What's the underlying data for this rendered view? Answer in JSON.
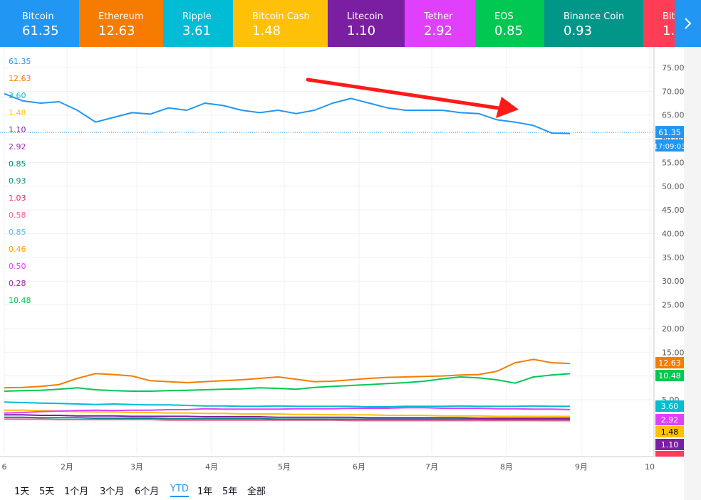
{
  "tiles": [
    {
      "name": "Bitcoin",
      "value": "61.35",
      "color": "#2196f3"
    },
    {
      "name": "Ethereum",
      "value": "12.63",
      "color": "#f57c00"
    },
    {
      "name": "Ripple",
      "value": "3.61",
      "color": "#00bcd4"
    },
    {
      "name": "Bitcoin Cash",
      "value": "1.48",
      "color": "#ffc107"
    },
    {
      "name": "Litecoin",
      "value": "1.10",
      "color": "#7b1fa2"
    },
    {
      "name": "Tether",
      "value": "2.92",
      "color": "#e040fb"
    },
    {
      "name": "EOS",
      "value": "0.85",
      "color": "#00c853"
    },
    {
      "name": "Binance Coin",
      "value": "0.93",
      "color": "#009688"
    },
    {
      "name": "Bit",
      "value": "1.",
      "color": "#ff3d57"
    }
  ],
  "next_icon": "chevron-right-icon",
  "legend_values": [
    {
      "text": "61.35",
      "color": "#2196f3"
    },
    {
      "text": "12.63",
      "color": "#f57c00"
    },
    {
      "text": "3.60",
      "color": "#00bcd4"
    },
    {
      "text": "1.48",
      "color": "#ffc107"
    },
    {
      "text": "1.10",
      "color": "#7b1fa2"
    },
    {
      "text": "2.92",
      "color": "#9c27b0"
    },
    {
      "text": "0.85",
      "color": "#00897b"
    },
    {
      "text": "0.93",
      "color": "#009688"
    },
    {
      "text": "1.03",
      "color": "#e91e63"
    },
    {
      "text": "0.58",
      "color": "#f06292"
    },
    {
      "text": "0.85",
      "color": "#64b5f6"
    },
    {
      "text": "0.46",
      "color": "#ffa000"
    },
    {
      "text": "0.50",
      "color": "#e040fb"
    },
    {
      "text": "0.28",
      "color": "#9c27b0"
    },
    {
      "text": "10.48",
      "color": "#00c853"
    }
  ],
  "timeframes": [
    "1天",
    "5天",
    "1个月",
    "3个月",
    "6个月",
    "YTD",
    "1年",
    "5年",
    "全部"
  ],
  "active_timeframe": "YTD",
  "chart_data": {
    "type": "line",
    "x_ticks": [
      "6",
      "2月",
      "3月",
      "4月",
      "5月",
      "6月",
      "7月",
      "8月",
      "9月",
      "10"
    ],
    "y_ticks": [
      "75.00",
      "70.00",
      "65.00",
      "60.00",
      "55.00",
      "50.00",
      "45.00",
      "40.00",
      "35.00",
      "30.00",
      "25.00",
      "20.00",
      "15.00",
      "10.00",
      "5.00"
    ],
    "ylim": [
      0,
      77
    ],
    "grid": true,
    "last_price_label": "61.35",
    "countdown": "17:09:03",
    "annotation": "red arrow pointing down-right toward August decline",
    "series": [
      {
        "color": "#2196f3",
        "last": "61.35",
        "values": [
          69.5,
          68,
          67.5,
          67.8,
          66,
          63.5,
          64.5,
          65.5,
          65.2,
          66.5,
          66,
          67.5,
          67,
          66,
          65.5,
          66,
          65.3,
          66,
          67.5,
          68.5,
          67.5,
          66.5,
          66,
          66,
          66,
          65.5,
          65.3,
          64,
          63.5,
          62.8,
          61.2,
          61.1
        ]
      },
      {
        "color": "#f57c00",
        "last": "12.63",
        "values": [
          7.5,
          7.6,
          7.8,
          8.2,
          9.5,
          10.5,
          10.3,
          10,
          9,
          8.8,
          8.6,
          8.8,
          9,
          9.2,
          9.5,
          9.8,
          9.3,
          8.8,
          8.9,
          9.2,
          9.5,
          9.7,
          9.8,
          9.9,
          10,
          10.2,
          10.3,
          11,
          12.8,
          13.5,
          12.8,
          12.63
        ]
      },
      {
        "color": "#00c853",
        "last": "10.48",
        "values": [
          6.8,
          6.9,
          7,
          7.2,
          7.5,
          7.1,
          6.9,
          6.8,
          6.8,
          6.9,
          7,
          7.1,
          7.2,
          7.3,
          7.5,
          7.4,
          7.2,
          7.6,
          7.8,
          8,
          8.2,
          8.4,
          8.6,
          8.9,
          9.4,
          9.8,
          9.6,
          9.2,
          8.5,
          9.8,
          10.2,
          10.48
        ]
      },
      {
        "color": "#00bcd4",
        "last": "3.60",
        "values": [
          4.5,
          4.4,
          4.3,
          4.2,
          4.1,
          4,
          4.1,
          4,
          3.9,
          3.9,
          3.8,
          3.7,
          3.7,
          3.6,
          3.6,
          3.7,
          3.6,
          3.6,
          3.6,
          3.6,
          3.5,
          3.5,
          3.6,
          3.6,
          3.6,
          3.7,
          3.6,
          3.6,
          3.6,
          3.7,
          3.6,
          3.6
        ]
      },
      {
        "color": "#e040fb",
        "last": "2.92",
        "values": [
          2.2,
          2.3,
          2.5,
          2.6,
          2.7,
          2.8,
          2.7,
          2.8,
          2.8,
          2.9,
          2.9,
          3.1,
          3,
          3,
          3,
          3,
          3.1,
          3.1,
          3.1,
          3.2,
          3.2,
          3.2,
          3.3,
          3.3,
          3.2,
          3.2,
          3.2,
          3.1,
          3.1,
          3,
          3,
          2.92
        ]
      },
      {
        "color": "#ffc107",
        "last": "1.48",
        "values": [
          2.8,
          2.8,
          2.7,
          2.6,
          2.5,
          2.4,
          2.4,
          2.3,
          2.3,
          2.2,
          2.2,
          2.1,
          2.1,
          2,
          2,
          2,
          1.9,
          1.9,
          1.8,
          1.8,
          1.8,
          1.7,
          1.7,
          1.7,
          1.6,
          1.6,
          1.6,
          1.5,
          1.5,
          1.5,
          1.5,
          1.48
        ]
      },
      {
        "color": "#7b1fa2",
        "last": "1.10",
        "values": [
          1.8,
          1.8,
          1.7,
          1.7,
          1.6,
          1.6,
          1.6,
          1.5,
          1.5,
          1.5,
          1.5,
          1.4,
          1.4,
          1.4,
          1.4,
          1.3,
          1.3,
          1.3,
          1.3,
          1.3,
          1.2,
          1.2,
          1.2,
          1.2,
          1.2,
          1.2,
          1.1,
          1.1,
          1.1,
          1.1,
          1.1,
          1.1
        ]
      },
      {
        "color": "#00897b",
        "last": "0.85",
        "values": [
          1.3,
          1.3,
          1.2,
          1.2,
          1.2,
          1.1,
          1.1,
          1.1,
          1.1,
          1,
          1,
          1,
          1,
          1,
          1,
          0.9,
          0.9,
          0.9,
          0.9,
          0.9,
          0.9,
          0.9,
          0.9,
          0.9,
          0.9,
          0.9,
          0.9,
          0.85,
          0.85,
          0.85,
          0.85,
          0.85
        ]
      },
      {
        "color": "#f06292",
        "last": "0.58",
        "values": [
          0.9,
          0.9,
          0.9,
          0.8,
          0.8,
          0.8,
          0.8,
          0.8,
          0.8,
          0.7,
          0.7,
          0.7,
          0.7,
          0.7,
          0.7,
          0.7,
          0.7,
          0.7,
          0.7,
          0.6,
          0.6,
          0.6,
          0.6,
          0.6,
          0.6,
          0.6,
          0.6,
          0.6,
          0.6,
          0.6,
          0.58,
          0.58
        ]
      }
    ],
    "right_labels": [
      {
        "text": "12.63",
        "color": "#f57c00"
      },
      {
        "text": "10.48",
        "color": "#00c853"
      },
      {
        "text": "3.60",
        "color": "#00bcd4"
      },
      {
        "text": "2.92",
        "color": "#e040fb"
      },
      {
        "text": "1.48",
        "color": "#ffc107"
      },
      {
        "text": "1.10",
        "color": "#7b1fa2"
      }
    ]
  }
}
